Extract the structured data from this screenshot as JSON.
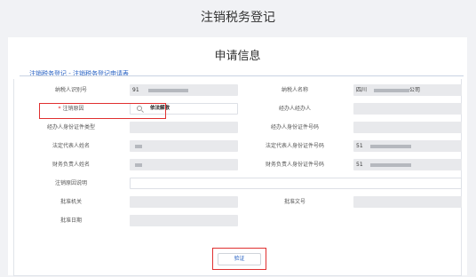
{
  "page_title": "注销税务登记",
  "card_title": "申请信息",
  "section_tab": "注销税务登记 - 注销税务登记申请表",
  "form": {
    "taxpayer_id_label": "纳税人识别号",
    "taxpayer_id_value": "91",
    "taxpayer_name_label": "纳税人名称",
    "taxpayer_name_prefix": "四川",
    "taxpayer_name_suffix": "公司",
    "cancel_reason_label": "注销原因",
    "cancel_reason_value": "依法解散",
    "agent_label": "经办人经办人",
    "agent_id_type_label": "经办人身份证件类型",
    "agent_id_no_label": "经办人身份证件号码",
    "legal_rep_name_label": "法定代表人姓名",
    "legal_rep_id_label": "法定代表人身份证件号码",
    "legal_rep_id_value": "51",
    "finance_head_name_label": "财务负责人姓名",
    "finance_head_id_label": "财务负责人身份证件号码",
    "finance_head_id_value": "51",
    "cancel_reason_desc_label": "注销原因说明",
    "approval_org_label": "批准机关",
    "approval_doc_label": "批准文号",
    "approval_date_label": "批准日期"
  },
  "verify_button": "验证",
  "colors": {
    "required": "#e02020",
    "highlight": "#e03030",
    "link": "#2a63c4"
  }
}
